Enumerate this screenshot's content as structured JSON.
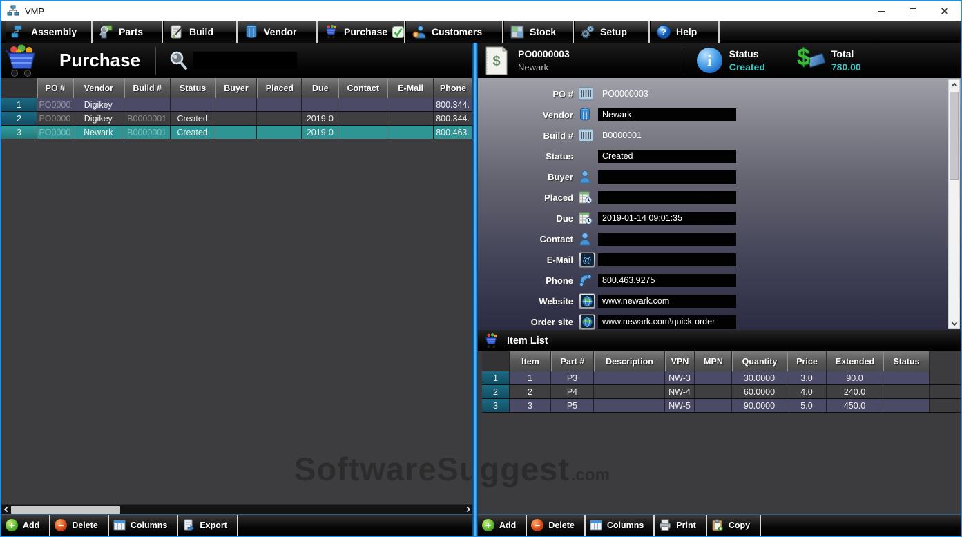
{
  "window": {
    "title": "VMP"
  },
  "menu": {
    "items": [
      {
        "label": "Assembly"
      },
      {
        "label": "Parts"
      },
      {
        "label": "Build"
      },
      {
        "label": "Vendor"
      },
      {
        "label": "Purchase"
      },
      {
        "label": "Customers"
      },
      {
        "label": "Stock"
      },
      {
        "label": "Setup"
      },
      {
        "label": "Help"
      }
    ]
  },
  "left": {
    "title": "Purchase",
    "search_value": "",
    "table": {
      "headers": [
        "",
        "PO #",
        "Vendor",
        "Build #",
        "Status",
        "Buyer",
        "Placed",
        "Due",
        "Contact",
        "E-Mail",
        "Phone"
      ],
      "rows": [
        [
          "1",
          "PO0000",
          "Digikey",
          "",
          "",
          "",
          "",
          "",
          "",
          "",
          "800.344."
        ],
        [
          "2",
          "PO0000",
          "Digikey",
          "B0000001",
          "Created",
          "",
          "",
          "2019-0",
          "",
          "",
          "800.344."
        ],
        [
          "3",
          "PO0000",
          "Newark",
          "B0000001",
          "Created",
          "",
          "",
          "2019-0",
          "",
          "",
          "800.463."
        ]
      ]
    },
    "toolbar": {
      "add": "Add",
      "delete": "Delete",
      "columns": "Columns",
      "export": "Export"
    }
  },
  "right": {
    "header": {
      "po_number": "PO0000003",
      "vendor": "Newark",
      "status_label": "Status",
      "status_value": "Created",
      "total_label": "Total",
      "total_value": "780.00"
    },
    "form": {
      "fields": [
        {
          "label": "PO #",
          "icon": "barcode-icon",
          "value": "PO0000003"
        },
        {
          "label": "Vendor",
          "icon": "vendor-icon",
          "value": "Newark"
        },
        {
          "label": "Build #",
          "icon": "barcode-icon",
          "value": "B0000001"
        },
        {
          "label": "Status",
          "icon": "",
          "value": "Created"
        },
        {
          "label": "Buyer",
          "icon": "person-icon",
          "value": ""
        },
        {
          "label": "Placed",
          "icon": "calendar-icon",
          "value": ""
        },
        {
          "label": "Due",
          "icon": "calendar-icon",
          "value": "2019-01-14 09:01:35"
        },
        {
          "label": "Contact",
          "icon": "person-icon",
          "value": ""
        },
        {
          "label": "E-Mail",
          "icon": "email-icon",
          "value": ""
        },
        {
          "label": "Phone",
          "icon": "phone-icon",
          "value": "800.463.9275"
        },
        {
          "label": "Website",
          "icon": "globe-icon",
          "value": "www.newark.com"
        },
        {
          "label": "Order site",
          "icon": "globe-icon",
          "value": "www.newark.com\\quick-order"
        }
      ]
    },
    "item_list": {
      "title": "Item List",
      "headers": [
        "",
        "Item",
        "Part #",
        "Description",
        "VPN",
        "MPN",
        "Quantity",
        "Price",
        "Extended",
        "Status"
      ],
      "rows": [
        [
          "1",
          "1",
          "P3",
          "",
          "NW-3",
          "",
          "30.0000",
          "3.0",
          "90.0",
          ""
        ],
        [
          "2",
          "2",
          "P4",
          "",
          "NW-4",
          "",
          "60.0000",
          "4.0",
          "240.0",
          ""
        ],
        [
          "3",
          "3",
          "P5",
          "",
          "NW-5",
          "",
          "90.0000",
          "5.0",
          "450.0",
          ""
        ]
      ]
    },
    "toolbar": {
      "add": "Add",
      "delete": "Delete",
      "columns": "Columns",
      "print": "Print",
      "copy": "Copy"
    }
  },
  "watermark": {
    "text": "SoftwareSuggest",
    "suffix": ".com"
  },
  "colors": {
    "accent_teal": "#3cc8c4",
    "row_purple": "#4b4b67",
    "row_grey": "#3f3f41",
    "row_selected_teal": "#2e9594",
    "row_number_teal": "#14566c",
    "divider_blue": "#1173c4",
    "input_bg": "#020202"
  }
}
